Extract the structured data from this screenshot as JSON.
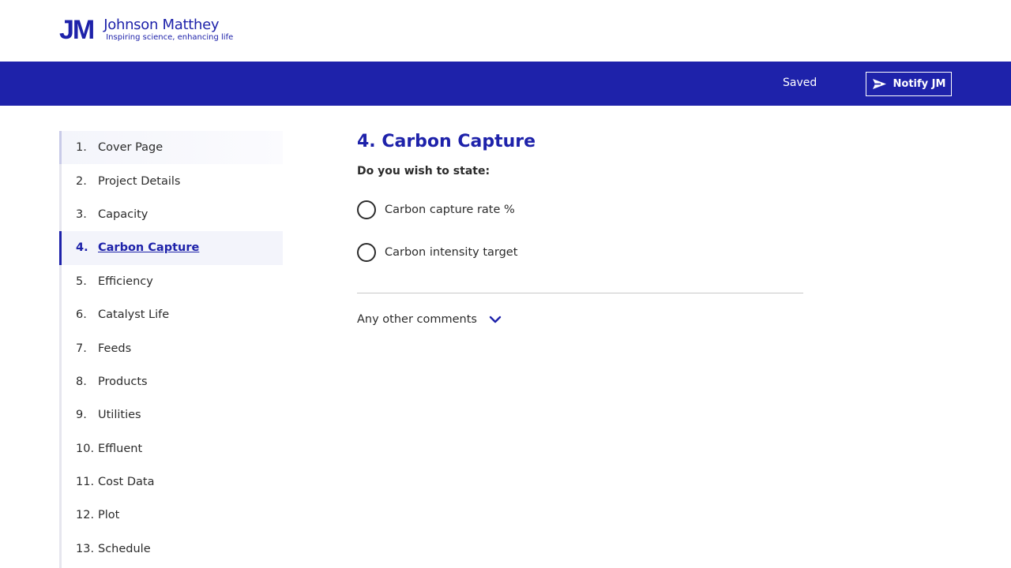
{
  "brand": {
    "mark": "JM",
    "name": "Johnson Matthey",
    "tagline": "Inspiring science, enhancing life",
    "color": "#1e22aa"
  },
  "toolbar": {
    "status": "Saved",
    "notify_label": "Notify JM",
    "notify_icon": "send-icon"
  },
  "sidebar": {
    "items": [
      {
        "num": "1.",
        "label": "Cover Page"
      },
      {
        "num": "2.",
        "label": "Project Details"
      },
      {
        "num": "3.",
        "label": "Capacity"
      },
      {
        "num": "4.",
        "label": "Carbon Capture"
      },
      {
        "num": "5.",
        "label": "Efficiency"
      },
      {
        "num": "6.",
        "label": "Catalyst Life"
      },
      {
        "num": "7.",
        "label": "Feeds"
      },
      {
        "num": "8.",
        "label": "Products"
      },
      {
        "num": "9.",
        "label": "Utilities"
      },
      {
        "num": "10.",
        "label": "Effluent"
      },
      {
        "num": "11.",
        "label": "Cost Data"
      },
      {
        "num": "12.",
        "label": "Plot"
      },
      {
        "num": "13.",
        "label": "Schedule"
      }
    ],
    "active_index": 3
  },
  "main": {
    "title": "4. Carbon Capture",
    "question": "Do you wish to state:",
    "options": [
      {
        "label": "Carbon capture rate %",
        "selected": false
      },
      {
        "label": "Carbon intensity target",
        "selected": false
      }
    ],
    "comments_label": "Any other comments",
    "comments_icon": "chevron-down-icon"
  }
}
